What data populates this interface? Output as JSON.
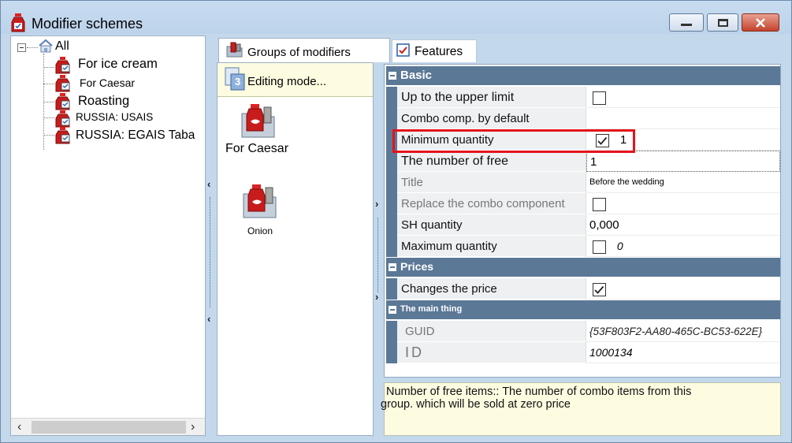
{
  "window": {
    "title": "Modifier schemes",
    "buttons": [
      "minimize",
      "restore",
      "close"
    ]
  },
  "tree": {
    "root": "All",
    "items": [
      {
        "label": "For ice cream"
      },
      {
        "label": "For Caesar"
      },
      {
        "label": "Roasting"
      },
      {
        "label": "RUSSIA: USAIS"
      },
      {
        "label": "RUSSIA: EGAIS Taba"
      }
    ]
  },
  "tabs": {
    "groups": "Groups of modifiers",
    "features": "Features"
  },
  "middle": {
    "editing_mode": "Editing mode...",
    "editing_badge": "3",
    "groups": [
      {
        "label": "For Caesar"
      },
      {
        "label": "Onion"
      }
    ]
  },
  "properties": {
    "categories": {
      "basic": "Basic",
      "prices": "Prices",
      "main": "The main thing"
    },
    "rows": {
      "upper_limit": {
        "name": "Up to the upper limit",
        "checked": false
      },
      "combo_default": {
        "name": "Combo comp. by default"
      },
      "min_qty": {
        "name": "Minimum quantity",
        "checked": true,
        "value": "1"
      },
      "num_free": {
        "name": "The number of free",
        "value": "1"
      },
      "title": {
        "name": "Title",
        "value": "Before the wedding"
      },
      "replace_combo": {
        "name": "Replace the combo component",
        "checked": false
      },
      "sh_qty": {
        "name": "SH quantity",
        "value": "0,000"
      },
      "max_qty": {
        "name": "Maximum quantity",
        "checked": false,
        "value": "0"
      },
      "changes_price": {
        "name": "Changes the price",
        "checked": true
      },
      "guid": {
        "name": "GUID",
        "value": "{53F803F2-AA80-465C-BC53-622E}"
      },
      "id": {
        "name": "ID",
        "value": "1000134"
      }
    }
  },
  "description": {
    "line1": "Number of free items:: The number of combo items from this",
    "line2": "group. which will be sold at zero price"
  },
  "colors": {
    "highlight": "#e4141a",
    "category_bg": "#5b7896",
    "window_bg": "#c4d8ec",
    "info_bg": "#fdfbe0"
  }
}
